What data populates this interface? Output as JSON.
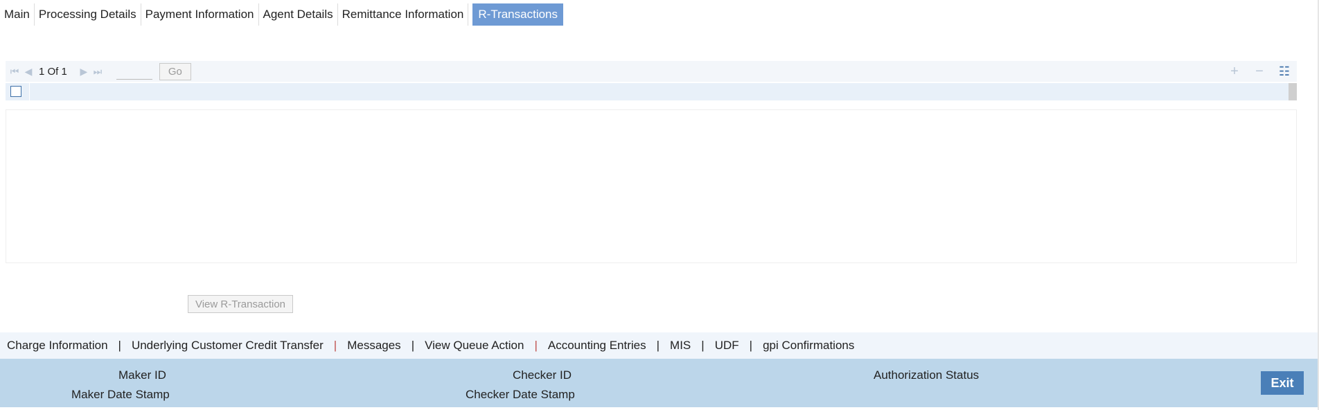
{
  "tabs": [
    {
      "label": "Main"
    },
    {
      "label": "Processing Details"
    },
    {
      "label": "Payment Information"
    },
    {
      "label": "Agent Details"
    },
    {
      "label": "Remittance Information"
    },
    {
      "label": "R-Transactions",
      "active": true
    }
  ],
  "grid": {
    "pager": {
      "current": "1",
      "of_label": "Of",
      "total": "1"
    },
    "page_input_value": "",
    "go_label": "Go",
    "icons": [
      "first-page-icon",
      "prev-page-icon",
      "next-page-icon",
      "last-page-icon",
      "add-row-icon",
      "delete-row-icon",
      "list-view-icon"
    ]
  },
  "actions": {
    "view_r_transaction": "View R-Transaction"
  },
  "links": [
    "Charge Information",
    "Underlying Customer Credit Transfer",
    "Messages",
    "View Queue Action",
    "Accounting Entries",
    "MIS",
    "UDF",
    "gpi Confirmations"
  ],
  "separator": "|",
  "footer": {
    "maker_id": "Maker ID",
    "maker_date_stamp": "Maker Date Stamp",
    "checker_id": "Checker ID",
    "checker_date_stamp": "Checker Date Stamp",
    "authorization_status": "Authorization Status",
    "exit": "Exit"
  },
  "colors": {
    "active_tab": "#6e9ad4",
    "footer_bg": "#bcd6ea",
    "exit_button": "#4a7fb8",
    "link_separator_accent": "#c0504d"
  }
}
